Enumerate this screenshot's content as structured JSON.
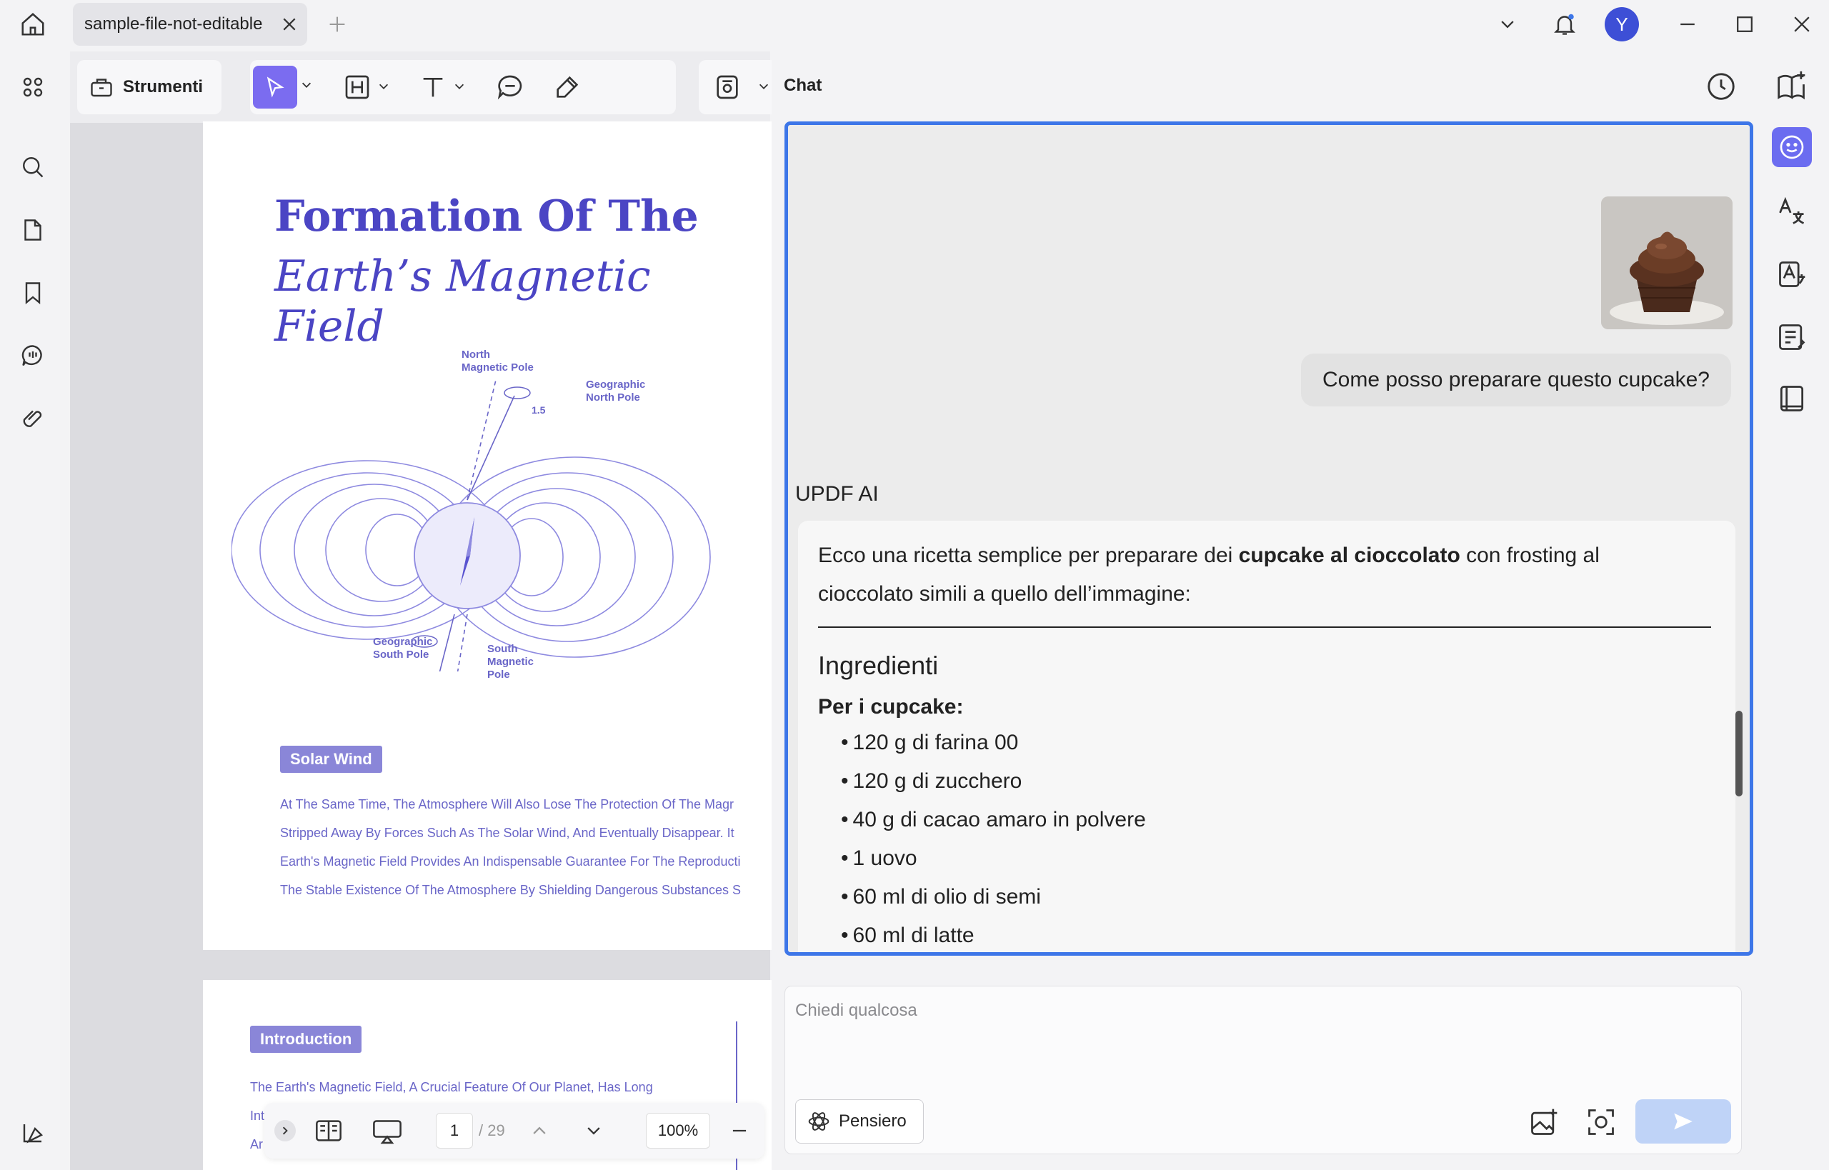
{
  "titlebar": {
    "tab_label": "sample-file-not-editable",
    "avatar_letter": "Y"
  },
  "toolbar": {
    "tools_label": "Strumenti"
  },
  "document": {
    "title_line1": "Formation Of The",
    "title_line2": "Earth’s Magnetic Field",
    "diagram_labels": {
      "north_magnetic": [
        "North",
        "Magnetic Pole"
      ],
      "geographic_north": [
        "Geographic",
        "North Pole"
      ],
      "angle": "1.5",
      "geographic_south": [
        "Geographic",
        "South Pole"
      ],
      "south_magnetic": [
        "South",
        "Magnetic",
        "Pole"
      ]
    },
    "section1_title": "Solar Wind",
    "section1_lines": [
      "At The Same Time, The Atmosphere Will Also Lose The Protection Of The Magr",
      "Stripped Away By Forces Such As The Solar Wind, And Eventually Disappear. It",
      "Earth's Magnetic Field Provides An Indispensable Guarantee For The Reproducti",
      "The Stable Existence Of The Atmosphere By Shielding Dangerous Substances S"
    ],
    "section2_title": "Introduction",
    "section2_lines": [
      "The Earth's Magnetic Field, A Crucial Feature Of Our Planet, Has Long",
      "Int",
      "Ar"
    ]
  },
  "bottombar": {
    "current_page": "1",
    "total_pages": "/ 29",
    "zoom": "100%"
  },
  "chat": {
    "title": "Chat",
    "user_message": "Come posso preparare questo cupcake?",
    "ai_name": "UPDF AI",
    "ai_intro_pre": "Ecco una ricetta semplice per preparare dei ",
    "ai_intro_bold": "cupcake al cioccolato",
    "ai_intro_post": " con frosting al cioccolato simili a quello dell’immagine:",
    "ingredients_heading": "Ingredienti",
    "cupcake_subheading": "Per i cupcake:",
    "ingredients": [
      "120 g di farina 00",
      "120 g di zucchero",
      "40 g di cacao amaro in polvere",
      "1 uovo",
      "60 ml di olio di semi",
      "60 ml di latte"
    ],
    "input_placeholder": "Chiedi qualcosa",
    "pensiero_label": "Pensiero"
  },
  "colors": {
    "accent": "#3d76e8",
    "pdf_purple": "#4b45c4",
    "select_tool": "#7b6cf0"
  }
}
